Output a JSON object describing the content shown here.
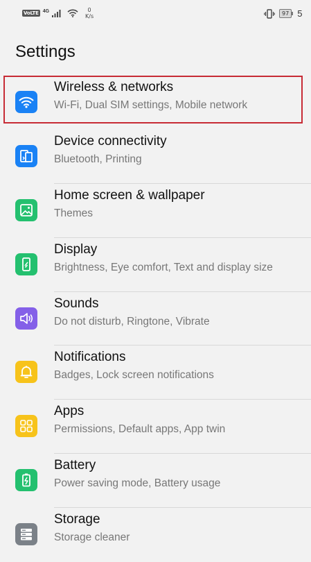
{
  "status_bar": {
    "volte": "VoLTE",
    "network": "4G",
    "speed_value": "0",
    "speed_unit": "K/s",
    "battery": "97",
    "time": "5"
  },
  "page": {
    "title": "Settings"
  },
  "items": [
    {
      "title": "Wireless & networks",
      "subtitle": "Wi-Fi, Dual SIM settings, Mobile network",
      "icon": "wifi-icon",
      "color": "#1a82f5"
    },
    {
      "title": "Device connectivity",
      "subtitle": "Bluetooth, Printing",
      "icon": "devices-icon",
      "color": "#1a82f5"
    },
    {
      "title": "Home screen & wallpaper",
      "subtitle": "Themes",
      "icon": "image-icon",
      "color": "#24c06f"
    },
    {
      "title": "Display",
      "subtitle": "Brightness, Eye comfort, Text and display size",
      "icon": "phone-brightness-icon",
      "color": "#24c06f"
    },
    {
      "title": "Sounds",
      "subtitle": "Do not disturb, Ringtone, Vibrate",
      "icon": "speaker-icon",
      "color": "#8460e8"
    },
    {
      "title": "Notifications",
      "subtitle": "Badges, Lock screen notifications",
      "icon": "bell-icon",
      "color": "#f7c31b"
    },
    {
      "title": "Apps",
      "subtitle": "Permissions, Default apps, App twin",
      "icon": "apps-grid-icon",
      "color": "#f7c31b"
    },
    {
      "title": "Battery",
      "subtitle": "Power saving mode, Battery usage",
      "icon": "battery-icon",
      "color": "#24c06f"
    },
    {
      "title": "Storage",
      "subtitle": "Storage cleaner",
      "icon": "storage-icon",
      "color": "#7b8188"
    }
  ],
  "highlight_color": "#c72b35"
}
